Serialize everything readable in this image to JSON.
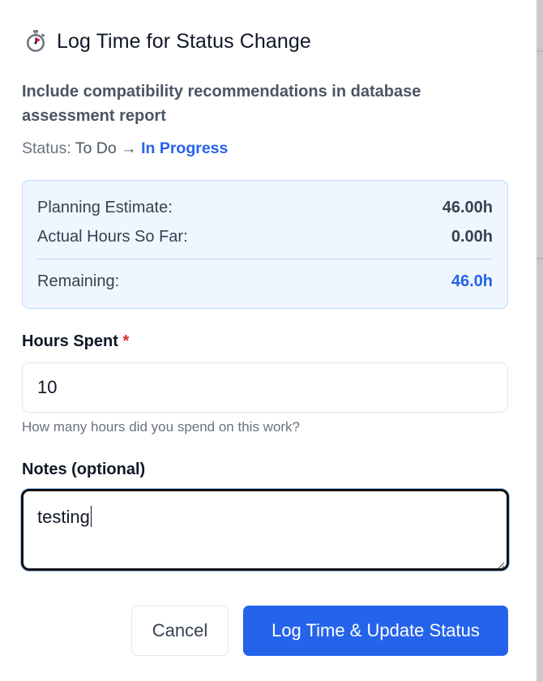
{
  "dialog": {
    "title": "Log Time for Status Change",
    "icon": "stopwatch-icon",
    "task_title": "Include compatibility recommendations in database assessment report",
    "status": {
      "prefix": "Status:",
      "from": "To Do",
      "arrow": "→",
      "to": "In Progress"
    },
    "estimates": {
      "planning_label": "Planning Estimate:",
      "planning_value": "46.00h",
      "actual_label": "Actual Hours So Far:",
      "actual_value": "0.00h",
      "remaining_label": "Remaining:",
      "remaining_value": "46.0h"
    },
    "hours": {
      "label": "Hours Spent",
      "required_mark": "*",
      "value": "10",
      "hint": "How many hours did you spend on this work?"
    },
    "notes": {
      "label": "Notes (optional)",
      "value": "testing"
    },
    "buttons": {
      "cancel": "Cancel",
      "submit": "Log Time & Update Status"
    }
  },
  "colors": {
    "primary": "#2563eb",
    "required": "#dc2626",
    "info_bg": "#eff6ff",
    "info_border": "#bfdbfe"
  }
}
